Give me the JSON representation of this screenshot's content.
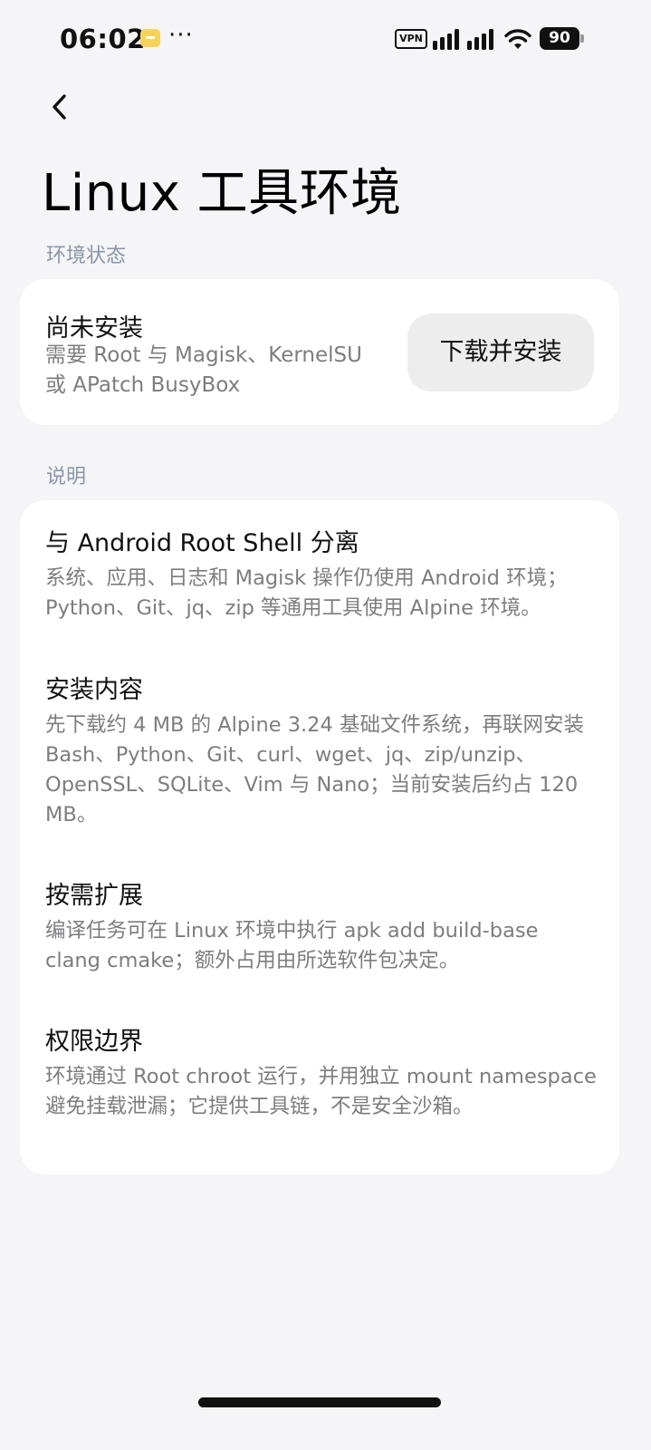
{
  "status_bar": {
    "time": "06:02",
    "more": "···",
    "vpn": "VPN",
    "battery": "90",
    "icons": [
      "message-notification-icon",
      "vpn-icon",
      "signal-icon",
      "wifi-icon",
      "battery-icon"
    ]
  },
  "header": {
    "back_icon": "chevron-left-icon",
    "title": "Linux 工具环境"
  },
  "status_section": {
    "label": "环境状态",
    "state_title": "尚未安装",
    "state_desc": "需要 Root 与 Magisk、KernelSU 或 APatch BusyBox",
    "install_button": "下载并安装"
  },
  "info_section": {
    "label": "说明",
    "items": [
      {
        "title": "与 Android Root Shell 分离",
        "body": "系统、应用、日志和 Magisk 操作仍使用 Android 环境；Python、Git、jq、zip 等通用工具使用 Alpine 环境。"
      },
      {
        "title": "安装内容",
        "body": "先下载约 4 MB 的 Alpine 3.24 基础文件系统，再联网安装 Bash、Python、Git、curl、wget、jq、zip/unzip、OpenSSL、SQLite、Vim 与 Nano；当前安装后约占 120 MB。"
      },
      {
        "title": "按需扩展",
        "body": "编译任务可在 Linux 环境中执行 apk add build-base clang cmake；额外占用由所选软件包决定。"
      },
      {
        "title": "权限边界",
        "body": "环境通过 Root chroot 运行，并用独立 mount namespace 避免挂载泄漏；它提供工具链，不是安全沙箱。"
      }
    ]
  },
  "colors": {
    "background": "#f5f5f7",
    "card": "#ffffff",
    "section_label": "#8a95a8",
    "secondary_text": "#7d7d80",
    "button_bg": "#ededee"
  }
}
